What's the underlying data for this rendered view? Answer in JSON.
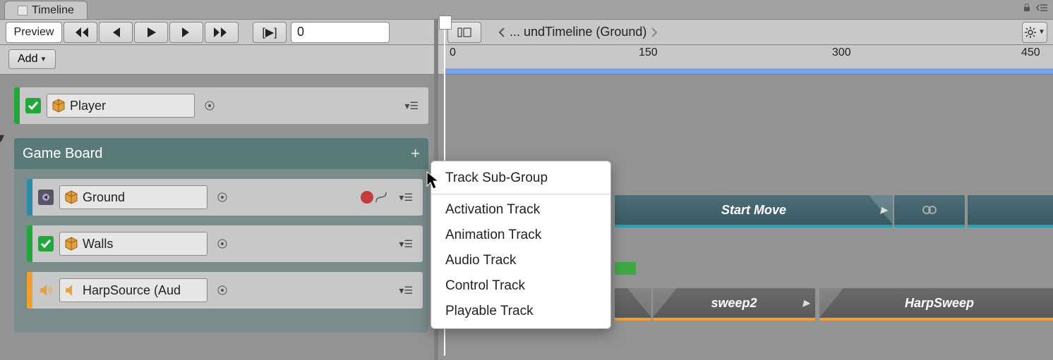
{
  "tab": {
    "title": "Timeline"
  },
  "toolbar": {
    "preview": "Preview",
    "frame_value": "0",
    "breadcrumb": "... undTimeline (Ground)"
  },
  "add_button": "Add",
  "ruler": {
    "ticks": [
      "0",
      "150",
      "300",
      "450"
    ]
  },
  "tracks": {
    "player": {
      "name": "Player"
    },
    "group": {
      "name": "Game Board",
      "ground": {
        "name": "Ground"
      },
      "walls": {
        "name": "Walls"
      },
      "harp": {
        "name": "HarpSource (Aud"
      }
    }
  },
  "clips": {
    "start_move": "Start Move",
    "sweep2": "sweep2",
    "harpsweep": "HarpSweep"
  },
  "context_menu": {
    "items": [
      "Track Sub-Group",
      "Activation Track",
      "Animation Track",
      "Audio Track",
      "Control Track",
      "Playable Track"
    ]
  },
  "colors": {
    "activation": "#22a83a",
    "animation": "#2a8aa8",
    "audio": "#f0a030"
  }
}
